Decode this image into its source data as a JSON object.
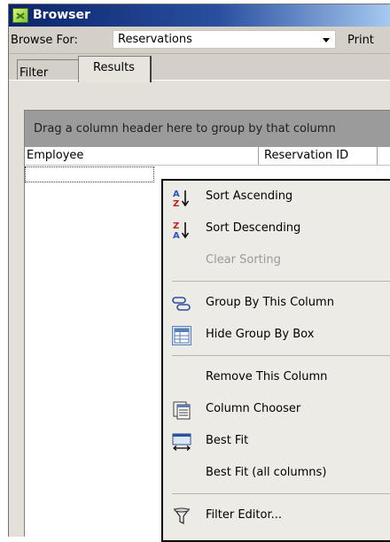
{
  "window": {
    "title": "Browser"
  },
  "browse": {
    "label": "Browse For:",
    "selected": "Reservations",
    "print_label": "Print"
  },
  "tabs": [
    {
      "label": "Filter"
    },
    {
      "label": "Results",
      "active": true
    }
  ],
  "grid": {
    "group_panel_text": "Drag a column header here to group by that column",
    "columns": [
      "Employee",
      "Reservation ID"
    ]
  },
  "context_menu": {
    "items": [
      {
        "label": "Sort Ascending",
        "icon": "sort-ascending-icon",
        "enabled": true
      },
      {
        "label": "Sort Descending",
        "icon": "sort-descending-icon",
        "enabled": true
      },
      {
        "label": "Clear Sorting",
        "icon": "",
        "enabled": false
      },
      {
        "label": "Group By This Column",
        "icon": "group-by-icon",
        "enabled": true
      },
      {
        "label": "Hide Group By Box",
        "icon": "group-box-icon",
        "enabled": true
      },
      {
        "label": "Remove This Column",
        "icon": "",
        "enabled": true
      },
      {
        "label": "Column Chooser",
        "icon": "column-chooser-icon",
        "enabled": true
      },
      {
        "label": "Best Fit",
        "icon": "best-fit-icon",
        "enabled": true
      },
      {
        "label": "Best Fit (all columns)",
        "icon": "",
        "enabled": true
      },
      {
        "label": "Filter Editor...",
        "icon": "filter-icon",
        "enabled": true
      }
    ]
  },
  "colors": {
    "title_bar": "#0a246a",
    "menu_bg": "#ecebe6",
    "group_panel": "#9b9b9b"
  }
}
